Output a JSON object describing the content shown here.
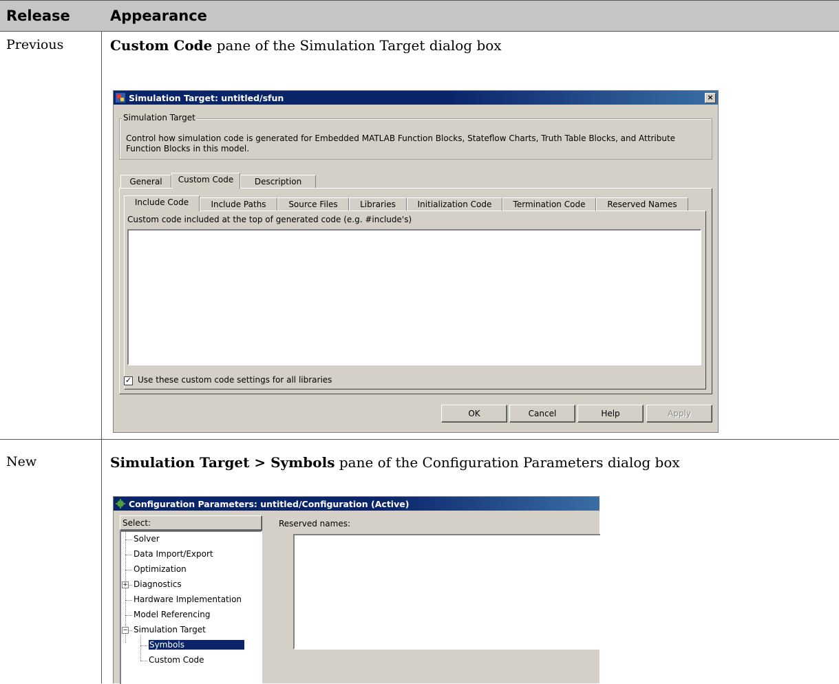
{
  "table": {
    "col_release": "Release",
    "col_appearance": "Appearance",
    "rows": [
      {
        "release": "Previous",
        "appearance_bold": "Custom Code",
        "appearance_rest": " pane of the Simulation Target dialog box"
      },
      {
        "release": "New",
        "appearance_bold": "Simulation Target > Symbols",
        "appearance_rest": " pane of the Configuration Parameters dialog box"
      }
    ]
  },
  "dialog1": {
    "title": "Simulation Target: untitled/sfun",
    "close": "×",
    "group_label": "Simulation Target",
    "group_desc_1": "Control how simulation code is generated for Embedded MATLAB Function Blocks, Stateflow Charts, Truth Table Blocks, and Attribute",
    "group_desc_2": "Function Blocks in this model.",
    "tabs": [
      "General",
      "Custom Code",
      "Description"
    ],
    "subtabs": [
      "Include Code",
      "Include Paths",
      "Source Files",
      "Libraries",
      "Initialization Code",
      "Termination Code",
      "Reserved Names"
    ],
    "code_label": "Custom code included at the top of generated code (e.g. #include's)",
    "checkbox_label": "Use these custom code settings for all libraries",
    "checkbox_mark": "✓",
    "buttons": {
      "ok": "OK",
      "cancel": "Cancel",
      "help": "Help",
      "apply": "Apply"
    }
  },
  "dialog2": {
    "title": "Configuration Parameters: untitled/Configuration (Active)",
    "select_label": "Select:",
    "reserved_label": "Reserved names:",
    "tree": [
      "Solver",
      "Data Import/Export",
      "Optimization",
      "Diagnostics",
      "Hardware Implementation",
      "Model Referencing",
      "Simulation Target",
      "Symbols",
      "Custom Code"
    ],
    "expand_plus": "+",
    "expand_minus": "−"
  },
  "colors": {
    "title_bar": "#0a246a",
    "header_bg": "#c5c5c5",
    "dialog_bg": "#d4d0c8",
    "selection": "#0a246a"
  }
}
